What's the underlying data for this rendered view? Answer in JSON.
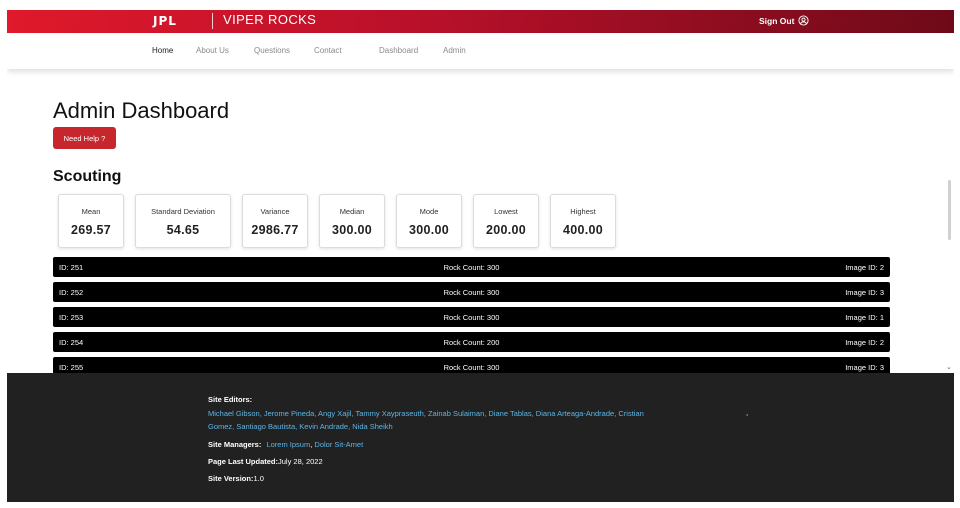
{
  "header": {
    "logo": "JPL",
    "site_title": "VIPER ROCKS",
    "signout_label": "Sign Out"
  },
  "nav": {
    "items": [
      "Home",
      "About Us",
      "Questions",
      "Contact",
      "Dashboard",
      "Admin"
    ]
  },
  "main": {
    "page_title": "Admin Dashboard",
    "help_button": "Need Help ?",
    "section_title": "Scouting",
    "stats": [
      {
        "label": "Mean",
        "value": "269.57"
      },
      {
        "label": "Standard Deviation",
        "value": "54.65"
      },
      {
        "label": "Variance",
        "value": "2986.77"
      },
      {
        "label": "Median",
        "value": "300.00"
      },
      {
        "label": "Mode",
        "value": "300.00"
      },
      {
        "label": "Lowest",
        "value": "200.00"
      },
      {
        "label": "Highest",
        "value": "400.00"
      }
    ],
    "rows": [
      {
        "id": "ID: 251",
        "rock": "Rock Count: 300",
        "image": "Image ID: 2"
      },
      {
        "id": "ID: 252",
        "rock": "Rock Count: 300",
        "image": "Image ID: 3"
      },
      {
        "id": "ID: 253",
        "rock": "Rock Count: 300",
        "image": "Image ID: 1"
      },
      {
        "id": "ID: 254",
        "rock": "Rock Count: 200",
        "image": "Image ID: 2"
      },
      {
        "id": "ID: 255",
        "rock": "Rock Count: 300",
        "image": "Image ID: 3"
      }
    ]
  },
  "footer": {
    "editors_label": "Site Editors:",
    "editors_line1": "Michael Gibson, Jerome Pineda, Angy Xajil, Tammy Xaypraseuth, Zainab Sulaiman, Diane Tablas, Diana Arteaga-Andrade, Cristian",
    "editors_line2": "Gomez, Santiago Bautista, Kevin Andrade, Nida Sheikh",
    "editors_trailing_comma": ",",
    "managers_label": "Site Managers:",
    "managers": [
      "Lorem Ipsum",
      "Dolor Sit-Amet"
    ],
    "updated_label": "Page Last Updated:",
    "updated_value": "July 28, 2022",
    "version_label": "Site Version:",
    "version_value": "1.0"
  },
  "colors": {
    "topbar_start": "#e0192b",
    "topbar_end": "#6e0a18",
    "help_button": "#c8262d",
    "footer_bg": "#212121",
    "link": "#5bb6e6"
  }
}
